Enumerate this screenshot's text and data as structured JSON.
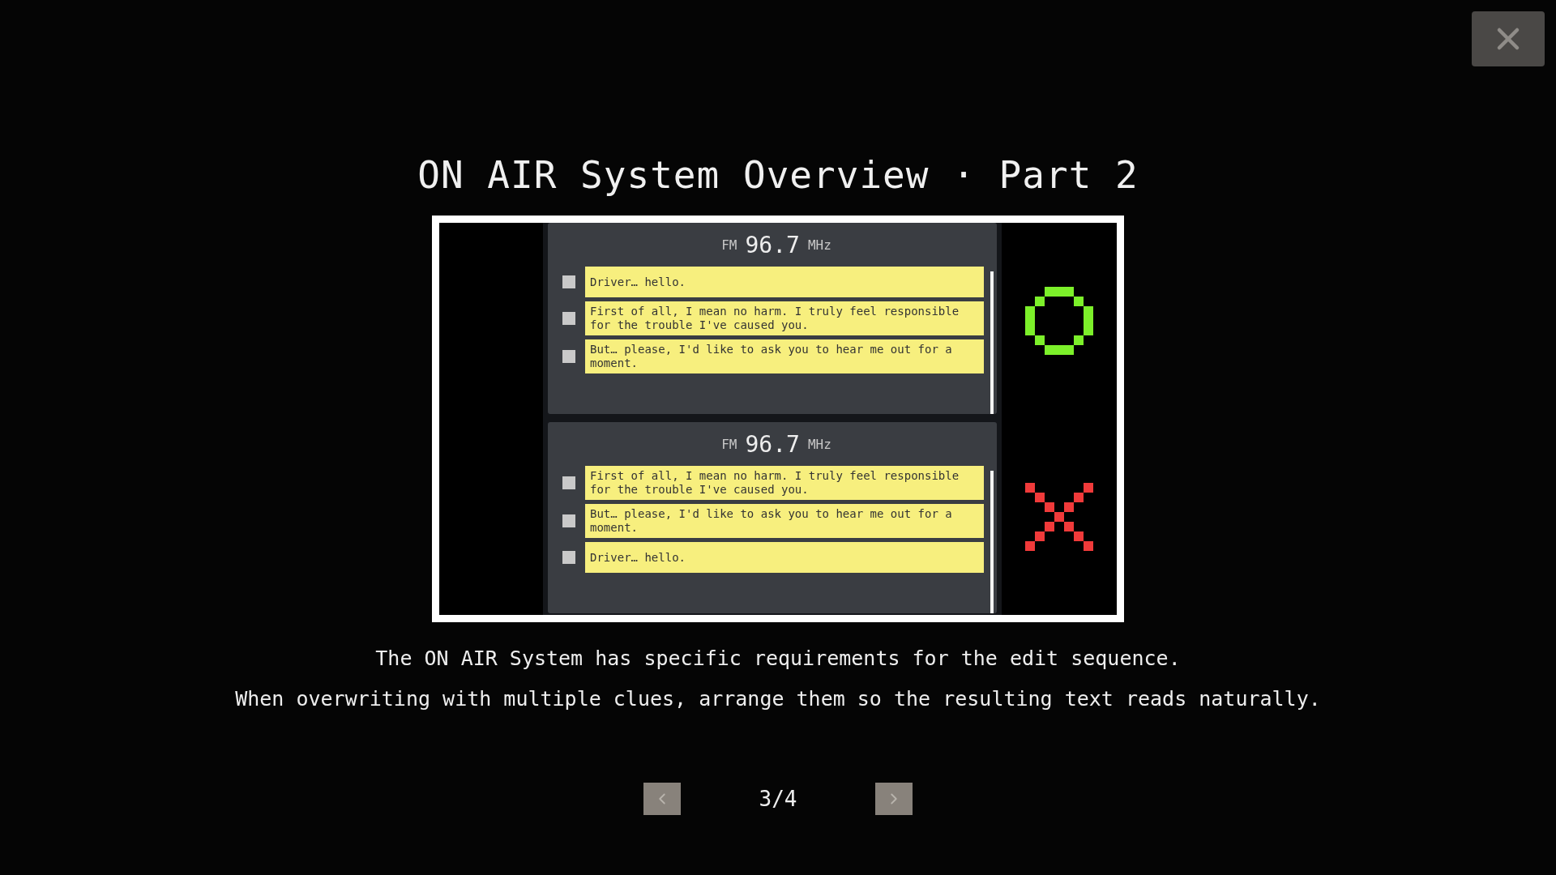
{
  "title": "ON AIR System Overview · Part 2",
  "examples": [
    {
      "kind": "correct",
      "band": "FM",
      "frequency": "96.7",
      "unit": "MHz",
      "lines": [
        {
          "text": "Driver… hello.",
          "checked": false
        },
        {
          "text": "First of all, I mean no harm. I truly feel responsible for the trouble I've caused you.",
          "checked": false
        },
        {
          "text": "But… please, I'd like to ask you to hear me out for a moment.",
          "checked": false
        }
      ]
    },
    {
      "kind": "wrong",
      "band": "FM",
      "frequency": "96.7",
      "unit": "MHz",
      "lines": [
        {
          "text": "First of all, I mean no harm. I truly feel responsible for the trouble I've caused you.",
          "checked": false
        },
        {
          "text": "But… please, I'd like to ask you to hear me out for a moment.",
          "checked": false
        },
        {
          "text": "Driver… hello.",
          "checked": false
        }
      ]
    }
  ],
  "caption": [
    "The ON AIR System has specific requirements for the edit sequence.",
    "When overwriting with multiple clues, arrange them so the resulting text reads naturally."
  ],
  "pager": {
    "current": "3/4"
  }
}
